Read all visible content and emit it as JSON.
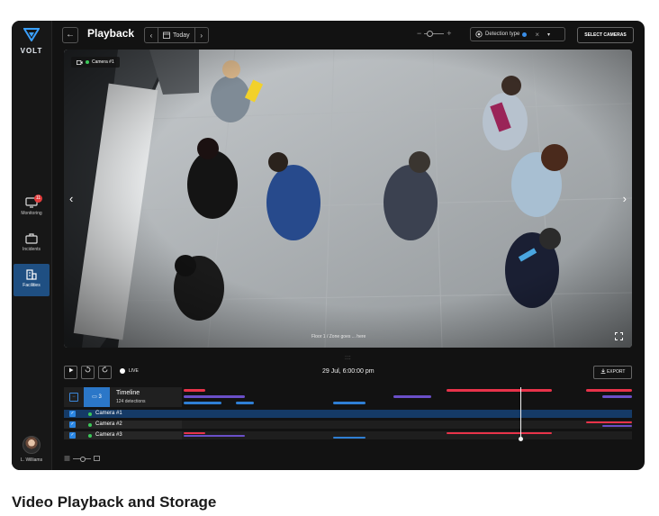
{
  "app": {
    "logo_text": "VOLT",
    "title": "Playback"
  },
  "sidebar": {
    "items": [
      {
        "label": "Monitoring",
        "badge": "11"
      },
      {
        "label": "Incidents"
      },
      {
        "label": "Facilities"
      }
    ],
    "active": "Facilities",
    "user_name": "L. Williams"
  },
  "topbar": {
    "back_symbol": "←",
    "date_label": "Today",
    "prev_symbol": "‹",
    "next_symbol": "›",
    "zoom_minus": "−",
    "zoom_plus": "+",
    "detection_type_label": "Detection type",
    "detection_clear_symbol": "×",
    "detection_dropdown_symbol": "▾",
    "select_cameras_label": "SELECT CAMERAS"
  },
  "video": {
    "camera_label": "Camera #1",
    "zone_caption": "Floor 1 / Zone goes ... here",
    "prev_arrow": "‹",
    "next_arrow": "›"
  },
  "controls": {
    "live_label": "LIVE",
    "timestamp": "29 Jul, 6:00:00 pm",
    "export_label": "EXPORT"
  },
  "timeline": {
    "camera_count": "3",
    "title": "Timeline",
    "detections": "124 detections",
    "cameras": [
      {
        "label": "Camera #1",
        "selected": true
      },
      {
        "label": "Camera #2",
        "selected": false
      },
      {
        "label": "Camera #3",
        "selected": false
      }
    ]
  },
  "caption": "Video Playback and Storage",
  "colors": {
    "accent": "#2b77c8",
    "event_red": "#e8334a",
    "event_purple": "#6a4fc8",
    "event_blue": "#2f7fd4",
    "online": "#3cc95a"
  }
}
